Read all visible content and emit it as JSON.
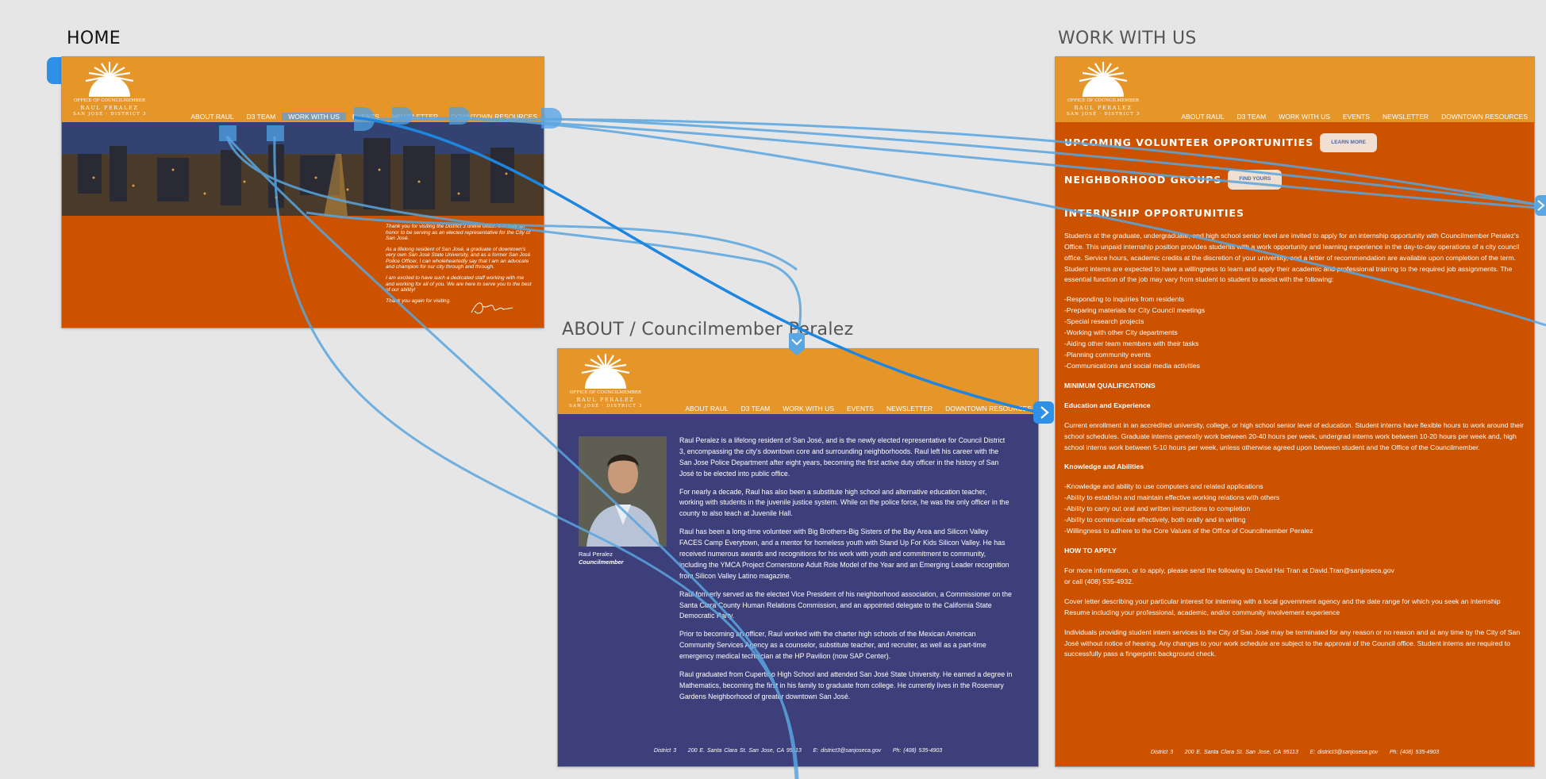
{
  "frames": {
    "home": "HOME",
    "work": "WORK WITH US",
    "about": "ABOUT / Councilmember Peralez"
  },
  "logo": {
    "line1": "OFFICE OF COUNCILMEMBER",
    "line2": "RAUL PERALEZ",
    "line3": "SAN JOSÉ · DISTRICT 3"
  },
  "nav": [
    "ABOUT RAUL",
    "D3 TEAM",
    "WORK WITH US",
    "EVENTS",
    "NEWSLETTER",
    "DOWNTOWN RESOURCES"
  ],
  "home": {
    "paragraphs": [
      "Thank you for visiting the District 3 online office. It is truly an honor to be serving as an elected representative for the City of San José.",
      "As a lifelong resident of San José, a graduate of downtown's very own San José State University, and as a former San José Police Officer, I can wholeheartedly say that I am an advocate and champion for our city through and through.",
      "I am excited to have such a dedicated staff working with me and working for all of you. We are here to serve you to the best of our ability!",
      "Thank you again for visiting."
    ]
  },
  "about": {
    "caption_name": "Raul Peralez",
    "caption_title": "Councilmember",
    "paragraphs": [
      "Raul Peralez is a lifelong resident of San José, and is the newly elected representative for Council District 3, encompassing the city's downtown core and surrounding neighborhoods. Raul left his career with the San Jose Police Department after eight years, becoming the first active duty officer in the history of San José to be elected into public office.",
      "For nearly a decade, Raul has also been a substitute high school and alternative education teacher, working with students in the juvenile justice system. While on the police force, he was the only officer in the county to also teach at Juvenile Hall.",
      "Raul has been a long-time volunteer with Big Brothers-Big Sisters of the Bay Area and Silicon Valley FACES Camp Everytown, and a mentor for homeless youth with Stand Up For Kids Silicon Valley. He has received numerous awards and recognitions for his work with youth and commitment to community, including the YMCA Project Cornerstone Adult Role Model of the Year and an Emerging Leader recognition from Silicon Valley Latino magazine.",
      "Raul formerly served as the elected Vice President of his neighborhood association, a Commissioner on the Santa Clara County Human Relations Commission, and an appointed delegate to the California State Democratic Party.",
      "Prior to becoming an officer, Raul worked with the charter high schools of the Mexican American Community Services Agency as a counselor, substitute teacher, and recruiter, as well as a part-time emergency medical technician at the HP Pavilion (now SAP Center).",
      "Raul graduated from Cupertino High School and attended San José State University. He earned a degree in Mathematics, becoming the first in his family to graduate from college. He currently lives in the Rosemary Gardens Neighborhood of greater downtown San José."
    ]
  },
  "footer": "District 3     200 E. Santa Clara St. San Jose, CA 95113     E: district3@sanjoseca.gov     Ph: (408) 535-4903",
  "work": {
    "volunteer_title": "UPCOMING VOLUNTEER OPPORTUNITIES",
    "volunteer_button": "LEARN MORE",
    "neighborhood_title": "NEIGHBORHOOD GROUPS",
    "neighborhood_button": "FIND YOURS",
    "internship_title": "INTERNSHIP OPPORTUNITIES",
    "intro": "Students at the graduate, undergraduate, and high school senior level are invited to apply for an internship opportunity with Councilmember Peralez's Office. This unpaid internship position provides students with a work opportunity and learning experience in the day-to-day operations of a city council office. Service hours, academic credits at the discretion of your university, and a letter of recommendation are available upon completion of the term. Student interns are expected to have a willingness to learn and apply their academic and professional training to the required job assignments. The essential function of the job may vary from student to student to assist with the following:",
    "duties": [
      "-Responding to inquiries from residents",
      "-Preparing materials for City Council meetings",
      "-Special research projects",
      "-Working with other City departments",
      "-Aiding other team members with their tasks",
      "-Planning community events",
      "-Communications and social media activities"
    ],
    "min_qual": "MINIMUM QUALIFICATIONS",
    "edu_head": "Education and Experience",
    "edu_text": "Current enrollment in an accredited university, college, or high school senior level of education. Student interns have flexible hours to work around their school schedules. Graduate interns generally work between 20-40 hours per week, undergrad interns work between 10-20 hours per week and, high school interns work between 5-10 hours per week, unless otherwise agreed upon between student and the Office of the Councilmember.",
    "ka_head": "Knowledge and Abilities",
    "abilities": [
      "-Knowledge and ability to use computers and related applications",
      "-Ability to establish and maintain effective working relations with others",
      "-Ability to carry out oral and written instructions to completion",
      "-Ability to communicate effectively, both orally and in writing",
      "-Willingness to adhere to the Core Values of the Office of Councilmember Peralez"
    ],
    "apply_head": "HOW TO APPLY",
    "apply_1": "For more information, or to apply, please send the following to David Hai Tran at David.Tran@sanjoseca.gov",
    "apply_1b": "or call (408) 535-4932.",
    "apply_2": "Cover letter describing your particular interest for interning with a local government agency and the date range for which you seek an internship",
    "apply_2b": "Resume including your professional, academic, and/or community involvement experience",
    "apply_3": "Individuals providing student intern services to the City of San José may be terminated for any reason or no reason and at any time by the City of San José without notice of hearing. Any changes to your work schedule are subject to the approval of the Council office. Student interns are required to successfully pass a fingerprint background check."
  },
  "colors": {
    "orange": "#e69528",
    "burnt": "#cc5200",
    "navy": "#3d3f7a",
    "link": "#2f8fe0"
  }
}
